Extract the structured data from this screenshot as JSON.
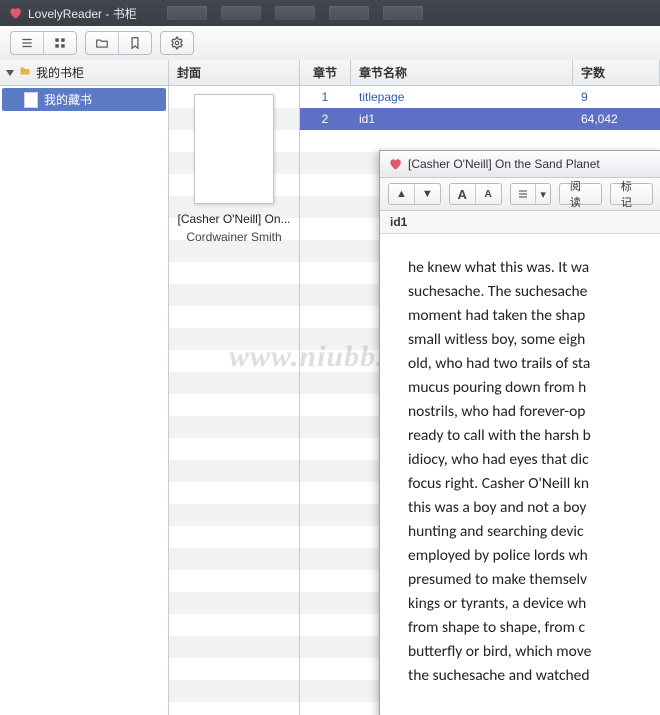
{
  "app": {
    "title": "LovelyReader - 书柜",
    "toolbar_icons": [
      "list-icon",
      "grid-icon",
      "folder-icon",
      "bookmark-icon",
      "gear-icon"
    ]
  },
  "sidebar": {
    "root": "我的书柜",
    "items": [
      {
        "label": "我的藏书"
      }
    ]
  },
  "book_panel": {
    "header": "封面",
    "title": "[Casher O'Neill] On...",
    "author": "Cordwainer Smith"
  },
  "chapters": {
    "headers": {
      "num": "章节",
      "name": "章节名称",
      "words": "字数"
    },
    "rows": [
      {
        "num": "1",
        "name": "titlepage",
        "words": "9",
        "selected": false
      },
      {
        "num": "2",
        "name": "id1",
        "words": "64,042",
        "selected": true
      }
    ]
  },
  "watermark": "www.niubb.ne",
  "reader": {
    "title": "[Casher O'Neill] On the Sand Planet",
    "toolbar": {
      "nav_up": "▲",
      "nav_down": "▼",
      "font_big": "A",
      "font_small": "A",
      "list": "list-icon",
      "read": "阅读",
      "mark": "标记"
    },
    "crumb": "id1",
    "body": "he knew what this was. It wa\nsuchesache. The suchesache\nmoment had taken the shap\nsmall witless boy, some eigh\nold, who had two trails of sta\nmucus pouring down from h\nnostrils, who had forever-op\nready to call with the harsh b\nidiocy, who had eyes that dic\nfocus right. Casher O'Neill kn\nthis was a boy and not a boy\nhunting and searching devic\nemployed by police lords wh\npresumed to make themselv\nkings or tyrants, a device wh\nfrom shape to shape, from c\nbutterfly or bird, which move\nthe suchesache and watched"
  }
}
